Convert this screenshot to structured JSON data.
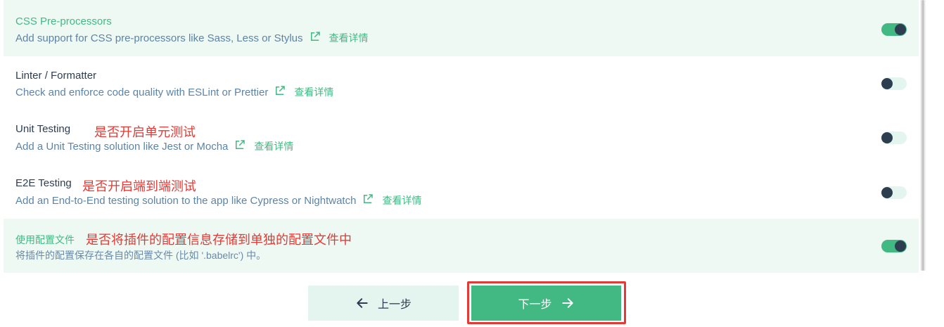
{
  "features": [
    {
      "title": "CSS Pre-processors",
      "description": "Add support for CSS pre-processors like Sass, Less or Stylus",
      "more_label": "查看详情",
      "note": "",
      "enabled": true
    },
    {
      "title": "Linter / Formatter",
      "description": "Check and enforce code quality with ESLint or Prettier",
      "more_label": "查看详情",
      "note": "",
      "enabled": false
    },
    {
      "title": "Unit Testing",
      "description": "Add a Unit Testing solution like Jest or Mocha",
      "more_label": "查看详情",
      "note": "是否开启单元测试",
      "enabled": false
    },
    {
      "title": "E2E Testing",
      "description": "Add an End-to-End testing solution to the app like Cypress or Nightwatch",
      "more_label": "查看详情",
      "note": "是否开启端到端测试",
      "enabled": false
    },
    {
      "title": "使用配置文件",
      "description": "将插件的配置保存在各自的配置文件 (比如 '.babelrc') 中。",
      "more_label": "",
      "note": "是否将插件的配置信息存储到单独的配置文件中",
      "enabled": true
    }
  ],
  "footer": {
    "prev_label": "上一步",
    "next_label": "下一步"
  },
  "colors": {
    "accent": "#42b983",
    "annotation": "#e53935",
    "selected_bg": "#eef9f4"
  }
}
